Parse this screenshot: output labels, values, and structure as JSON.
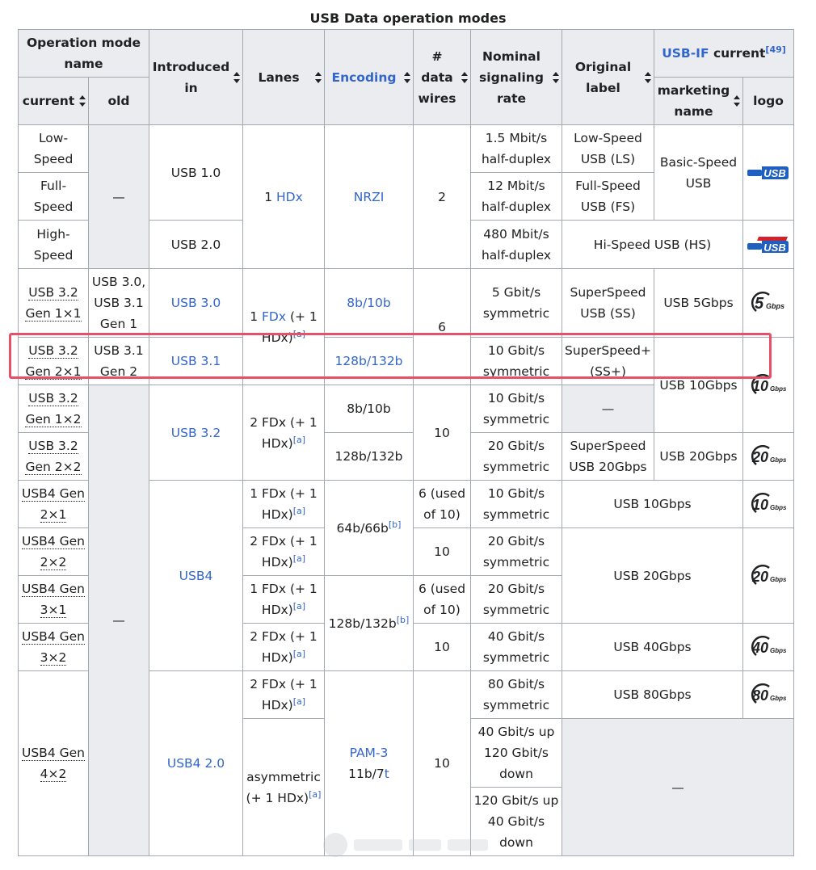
{
  "caption": "USB Data operation modes",
  "headers": {
    "operation_mode_name": "Operation mode name",
    "current": "current",
    "old": "old",
    "introduced_in": "Introduced in",
    "lanes": "Lanes",
    "encoding": "Encoding",
    "data_wires": "# data wires",
    "nominal_rate": "Nominal signaling rate",
    "original_label": "Original label",
    "usbif_current_link": "USB-IF",
    "usbif_current_text": " current",
    "usbif_ref": "[49]",
    "marketing_name": "marketing name",
    "logo": "logo"
  },
  "cells": {
    "low_speed": "Low-Speed",
    "full_speed": "Full-Speed",
    "high_speed": "High-Speed",
    "dash": "—",
    "usb10": "USB 1.0",
    "usb20": "USB 2.0",
    "lanes_1hdx_a": "1 ",
    "lanes_1hdx_link": "HDx",
    "nrzi": "NRZI",
    "two": "2",
    "r_15": "1.5 Mbit/s half-duplex",
    "r_12": "12 Mbit/s half-duplex",
    "r_480": "480 Mbit/s half-duplex",
    "lbl_ls": "Low-Speed USB (LS)",
    "lbl_fs": "Full-Speed USB (FS)",
    "lbl_hs": "Hi-Speed USB (HS)",
    "basic_speed": "Basic-Speed USB",
    "g1x1": "USB 3.2 Gen 1×1",
    "old_g1x1": "USB 3.0, USB 3.1 Gen 1",
    "usb30": "USB 3.0",
    "fdx_a": "1 ",
    "fdx_link": "FDx",
    "fdx_b": " (+ 1 HDx)",
    "ref_a": "[a]",
    "ref_b": "[b]",
    "enc_8b10b": "8b/10b",
    "six": "6",
    "r_5g": "5 Gbit/s symmetric",
    "lbl_ss": "SuperSpeed USB (SS)",
    "usb5g": "USB 5Gbps",
    "g2x1": "USB 3.2 Gen 2×1",
    "old_g2x1": "USB 3.1 Gen 2",
    "usb31": "USB 3.1",
    "enc_128b": "128b/132b",
    "r_10g": "10 Gbit/s symmetric",
    "lbl_ssp": "SuperSpeed+ (SS+)",
    "usb10g": "USB 10Gbps",
    "g1x2": "USB 3.2 Gen 1×2",
    "usb32": "USB 3.2",
    "fdx2": "2 FDx (+ 1 HDx)",
    "ten": "10",
    "g2x2": "USB 3.2 Gen 2×2",
    "r_20g": "20 Gbit/s symmetric",
    "lbl_ss20": "SuperSpeed USB 20Gbps",
    "usb20g": "USB 20Gbps",
    "u4g2x1": "USB4 Gen 2×1",
    "usb4": "USB4",
    "fdx1": "1 FDx (+ 1 HDx)",
    "enc_64b": "64b/66b",
    "six_used": "6 (used of 10)",
    "u4g2x2": "USB4 Gen 2×2",
    "u4g3x1": "USB4 Gen 3×1",
    "enc_128b_b": "128b/132b",
    "u4g3x2": "USB4 Gen 3×2",
    "r_40g": "40 Gbit/s symmetric",
    "usb40g": "USB 40Gbps",
    "u4g4x2": "USB4 Gen 4×2",
    "usb4_20": "USB4 2.0",
    "r_80g": "80 Gbit/s symmetric",
    "usb80g": "USB 80Gbps",
    "asym": "asymmetric (+ 1 HDx)",
    "pam3": "PAM-3",
    "enc_11b7": "11b/7",
    "enc_t": "t",
    "r_40_120": "40 Gbit/s up 120 Gbit/s down",
    "r_120_40": "120 Gbit/s up 40 Gbit/s down"
  },
  "logos": {
    "basic_usb": "USB",
    "hi_usb": "USB",
    "g5": "5",
    "g10": "10",
    "g20": "20",
    "g40": "40",
    "g80": "80",
    "gbps": "Gbps",
    "certified": "CERTIFIED",
    "hispeed": "HI-SPEED"
  },
  "colors": {
    "link": "#3366cc",
    "header_bg": "#eaecf0",
    "border": "#a2a9b1",
    "highlight": "#e8506a"
  }
}
